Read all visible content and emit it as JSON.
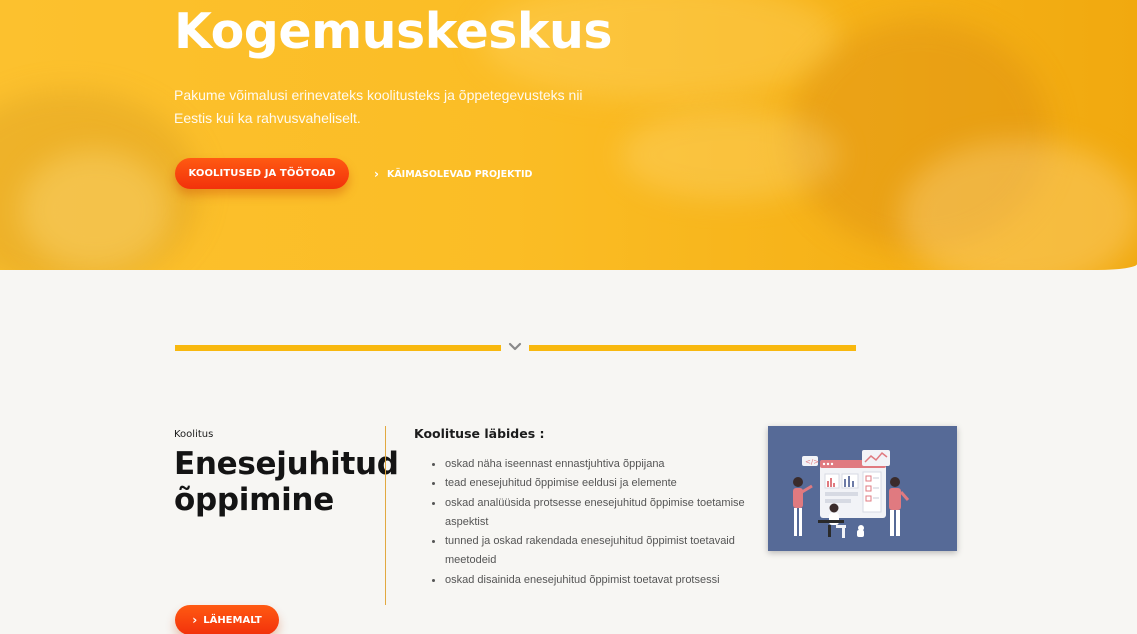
{
  "hero": {
    "title": "Kogemuskeskus",
    "description": "Pakume võimalusi erinevateks koolitusteks ja õppetegevusteks nii Eestis kui ka rahvusvaheliselt.",
    "primary_button": "KOOLITUSED JA TÖÖTOAD",
    "secondary_link": "KÄIMASOLEVAD PROJEKTID",
    "accent_color": "#fbbd25"
  },
  "divider": {
    "icon": "chevron-down-icon",
    "color": "#f8b80e"
  },
  "course": {
    "kicker": "Koolitus",
    "title": "Enesejuhitud õppimine",
    "outcomes_title": "Koolituse läbides :",
    "outcomes": [
      "oskad näha iseennast ennastjuhtiva õppijana",
      "tead enesejuhitud õppimise eeldusi ja elemente",
      "oskad analüüsida protsesse enesejuhitud õppimise toetamise aspektist",
      "tunned ja oskad rakendada enesejuhitud õppimist toetavaid meetodeid",
      "oskad disainida enesejuhitud õppimist toetavat protsessi"
    ],
    "more_button": "LÄHEMALT",
    "illustration_icon": "team-dashboard-illustration",
    "button_color": "#f2310b"
  }
}
